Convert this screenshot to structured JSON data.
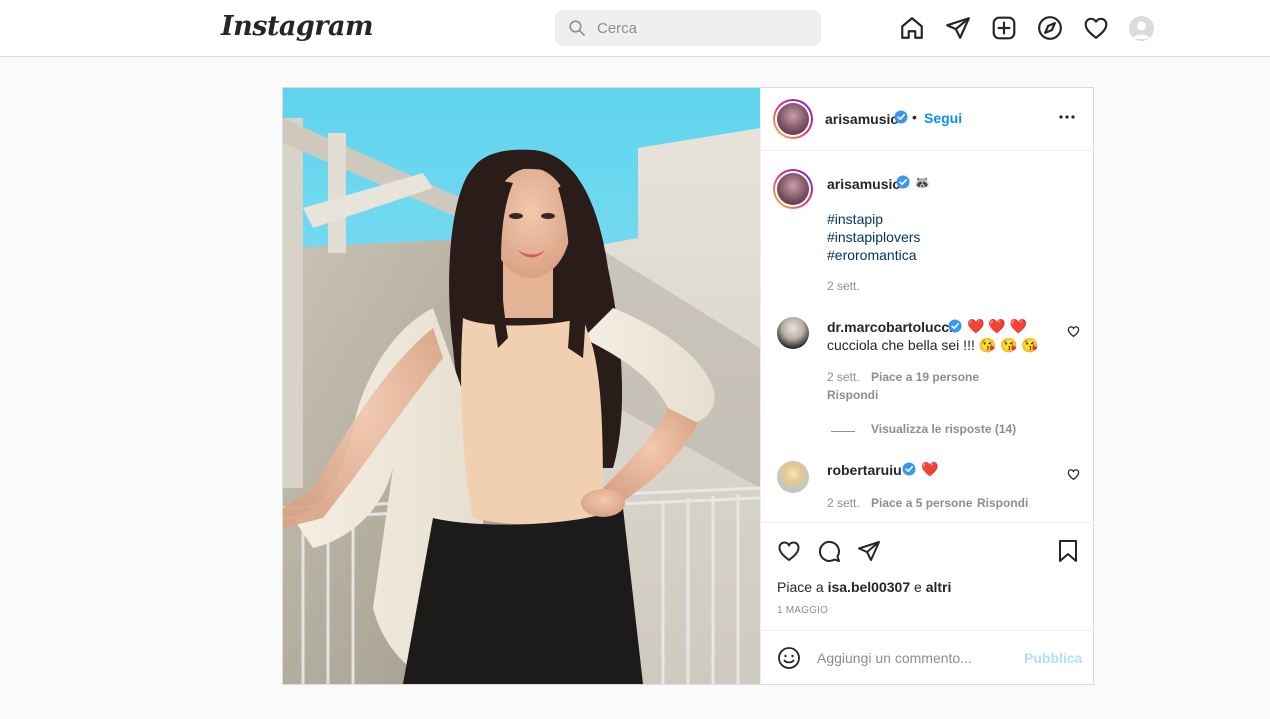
{
  "topbar": {
    "logo": "Instagram",
    "search_placeholder": "Cerca",
    "nav_icons": [
      "home-icon",
      "direct-icon",
      "new-post-icon",
      "explore-icon",
      "activity-icon"
    ]
  },
  "post": {
    "author": "arisamusic",
    "follow_label": "Segui",
    "caption": {
      "username": "arisamusic",
      "emoji": "🦝",
      "hashtags": [
        "#instapip",
        "#instapiplovers",
        "#eroromantica"
      ],
      "time": "2 sett."
    },
    "comments": [
      {
        "username": "dr.marcobartolucci",
        "line1": "❤️ ❤️ ❤️",
        "line2": "cucciola che bella sei !!! 😘 😘 😘",
        "time": "2 sett.",
        "likes": "Piace a 19 persone",
        "reply": "Rispondi",
        "view_replies": "Visualizza le risposte (14)"
      },
      {
        "username": "robertaruiu",
        "line1": "❤️",
        "time": "2 sett.",
        "likes": "Piace a 5 persone",
        "reply": "Rispondi"
      }
    ],
    "likes_prefix": "Piace a",
    "liked_by": "isa.bel00307",
    "likes_and": "e",
    "likes_others": "altri",
    "date": "1 MAGGIO",
    "add_comment_placeholder": "Aggiungi un commento...",
    "publish_label": "Pubblica"
  },
  "colors": {
    "accent": "#0095f6",
    "verified": "#3897f0",
    "border": "#dbdbdb",
    "publish_disabled": "#b2dffc"
  }
}
